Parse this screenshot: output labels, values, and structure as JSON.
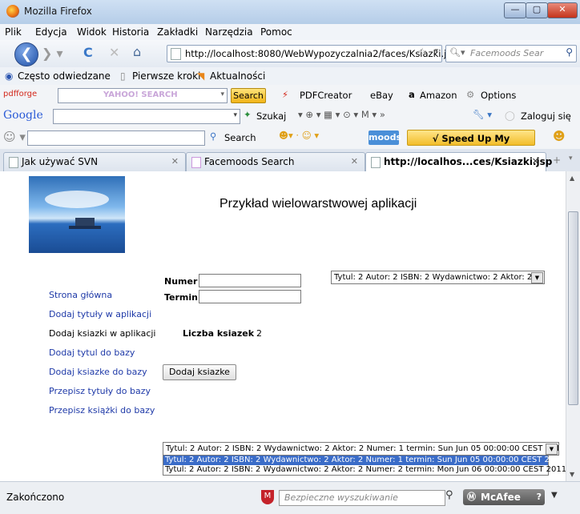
{
  "window": {
    "title": "Mozilla Firefox",
    "min": "—",
    "max": "▢",
    "close": "✕"
  },
  "menu": [
    "Plik",
    "Edycja",
    "Widok",
    "Historia",
    "Zakładki",
    "Narzędzia",
    "Pomoc"
  ],
  "nav": {
    "url": "http://localhost:8080/WebWypozyczalnia2/faces/Ksiazki.j",
    "search_placeholder": "Facemoods Sear"
  },
  "bookmarks": [
    "Często odwiedzane",
    "Pierwsze kroki",
    "Aktualności"
  ],
  "toolbar1": {
    "brand": "pdfforge",
    "yahoo_field": "YAHOO! SEARCH",
    "search_btn": "Search",
    "pdfcreator": "PDFCreator",
    "ebay": "eBay",
    "amazon": "Amazon",
    "options": "Options"
  },
  "toolbar2": {
    "google": "Google",
    "szukaj": "Szukaj",
    "zaloguj": "Zaloguj się"
  },
  "toolbar3": {
    "search": "Search",
    "moods": "moods",
    "speedup": "√ Speed Up My Computer"
  },
  "tabs": [
    {
      "label": "Jak używać SVN"
    },
    {
      "label": "Facemoods Search"
    },
    {
      "label": "http://localhos...ces/Ksiazki.jsp"
    }
  ],
  "page": {
    "heading": "Przykład wielowarstwowej aplikacji",
    "sidebar": [
      {
        "label": "Strona główna",
        "link": true
      },
      {
        "label": "Dodaj tytuły w aplikacji",
        "link": true
      },
      {
        "label": "Dodaj ksiazki w aplikacji",
        "link": false
      },
      {
        "label": "Dodaj tytul do bazy",
        "link": true
      },
      {
        "label": "Dodaj ksiazke do bazy",
        "link": true
      },
      {
        "label": "Przepisz tytuły do bazy",
        "link": true
      },
      {
        "label": "Przepisz książki do bazy",
        "link": true
      }
    ],
    "form": {
      "numer_label": "Numer",
      "numer_value": "",
      "termin_label": "Termin",
      "termin_value": "",
      "title_select": "Tytul: 2 Autor: 2 ISBN: 2 Wydawnictwo: 2 Aktor: 2",
      "count_label": "Liczba ksiazek",
      "count_value": "2",
      "add_button": "Dodaj ksiazke"
    },
    "books_dropdown": {
      "selected": "Tytul: 2 Autor: 2 ISBN: 2 Wydawnictwo: 2 Aktor: 2 Numer: 1 termin: Sun Jun 05 00:00:00 CEST 2011",
      "options": [
        "Tytul: 2 Autor: 2 ISBN: 2 Wydawnictwo: 2 Aktor: 2 Numer: 1 termin: Sun Jun 05 00:00:00 CEST 2011",
        "Tytul: 2 Autor: 2 ISBN: 2 Wydawnictwo: 2 Aktor: 2 Numer: 2 termin: Mon Jun 06 00:00:00 CEST 2011"
      ]
    }
  },
  "status": {
    "text": "Zakończono",
    "mcafee_search": "Bezpieczne wyszukiwanie",
    "mcafee": "McAfee"
  }
}
